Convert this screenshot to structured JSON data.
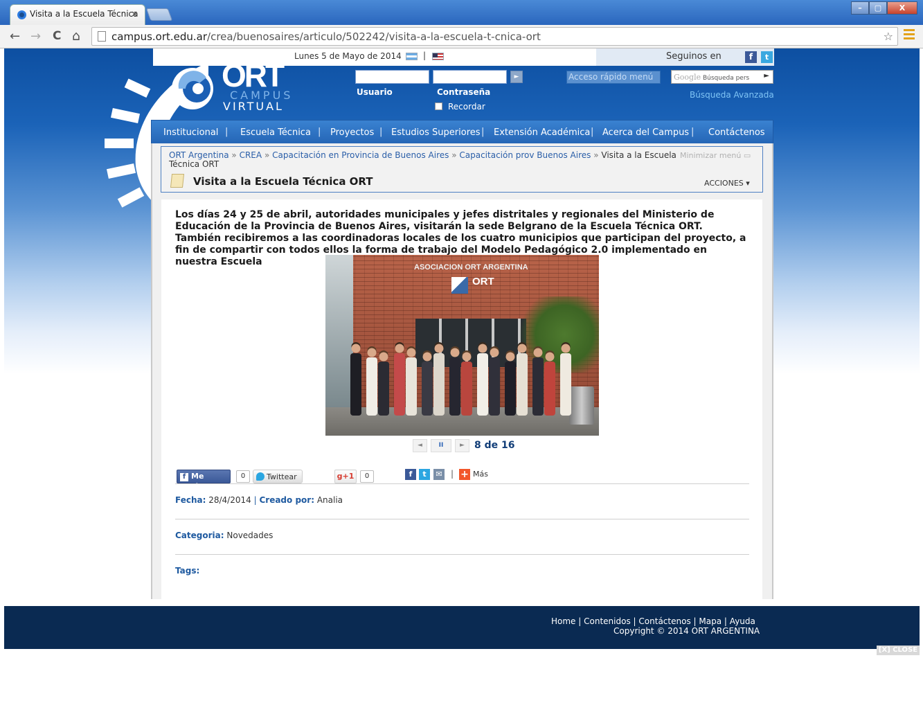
{
  "browser": {
    "tab_title": "Visita a la Escuela Técnica",
    "tab_close": "×",
    "url_host": "campus.ort.edu.ar",
    "url_path": "/crea/buenosaires/articulo/502242/visita-a-la-escuela-t-cnica-ort",
    "back": "←",
    "forward": "→",
    "reload": "C",
    "home": "⌂",
    "window_buttons": [
      "–",
      "▢",
      "X"
    ]
  },
  "header": {
    "date": "Lunes 5 de Mayo de 2014",
    "lang_sep": "|",
    "follow_us": "Seguinos en",
    "facebook": "f",
    "twitter": "t",
    "logo_main": "ORT",
    "logo_campus": "CAMPUS",
    "logo_virtual": "VIRTUAL",
    "username_label": "Usuario",
    "password_label": "Contraseña",
    "remember_label": "Recordar",
    "login_go": "►",
    "quick_menu": "Acceso rápido menú",
    "google_brand": "Google",
    "google_placeholder": "Búsqueda pers",
    "google_go": "►",
    "advanced_search": "Búsqueda Avanzada"
  },
  "nav": {
    "items": [
      "Institucional",
      "Escuela Técnica",
      "Proyectos",
      "Estudios Superiores",
      "Extensión Académica",
      "Acerca del Campus",
      "Contáctenos"
    ],
    "separator": "|"
  },
  "breadcrumb": {
    "items": [
      "ORT Argentina",
      "CREA",
      "Capacitación en Provincia de Buenos Aires",
      "Capacitación prov Buenos Aires"
    ],
    "separator": "»",
    "current_line1": "Visita a la Escuela",
    "current_line2": "Técnica ORT",
    "minimize": "Minimizar menú"
  },
  "article": {
    "title": "Visita a la Escuela Técnica ORT",
    "actions": "ACCIONES ▾",
    "lead": "Los días 24 y 25 de abril, autoridades municipales y jefes distritales y regionales del Ministerio de Educación de la Provincia de Buenos Aires, visitarán la sede Belgrano de la Escuela Técnica ORT. También recibiremos a las coordinadoras locales de los cuatro municipios que participan del proyecto, a fin de compartir con todos ellos la forma de trabajo del Modelo Pedagógico 2.0 implementado en nuestra Escuela",
    "photo_sign": "ASOCIACION ORT ARGENTINA",
    "photo_logo": "ORT",
    "slideshow": {
      "prev": "◄",
      "pause": "II",
      "next": "►",
      "counter": "8 de 16",
      "current": 8,
      "total": 16
    },
    "social": {
      "like": "Me gusta",
      "like_count": "0",
      "tweet": "Twittear",
      "gplus": "g+1",
      "gplus_count": "0",
      "share_fb": "f",
      "share_tw": "t",
      "share_mail": "✉",
      "share_sep": "|",
      "share_more_icon": "+",
      "more": "Más"
    },
    "fecha_label": "Fecha:",
    "fecha_value": "28/4/2014",
    "meta_sep": "|",
    "author_label": "Creado por:",
    "author_value": "Analia",
    "category_label": "Categoria:",
    "category_value": "Novedades",
    "tags_label": "Tags:"
  },
  "footer": {
    "links": [
      "Home",
      "Contenidos",
      "Contáctenos",
      "Mapa",
      "Ayuda"
    ],
    "separator": "|",
    "copyright": "Copyright © 2014 ORT ARGENTINA",
    "close": "[X] CLOSE"
  },
  "colors": {
    "header_blue": "#1b63b8",
    "nav_blue": "#2a6fc2",
    "link_blue": "#2a5ea8",
    "footer_navy": "#0a2a52",
    "facebook_blue": "#3b5998",
    "twitter_blue": "#2ba6e1"
  }
}
